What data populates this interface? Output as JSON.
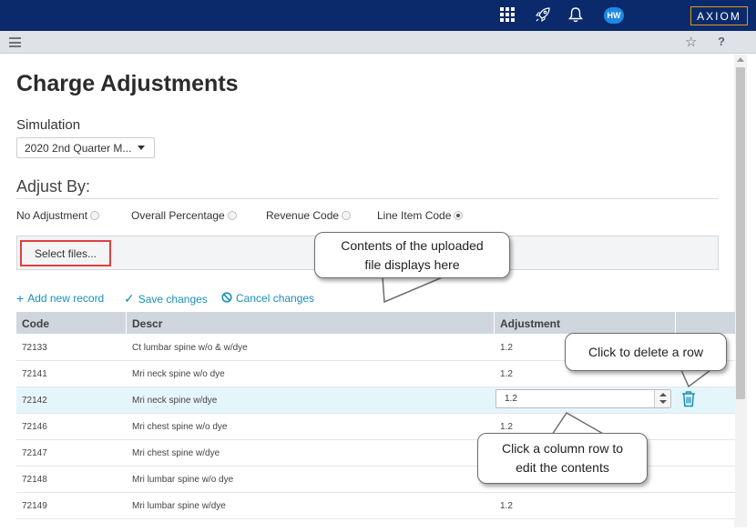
{
  "topbar": {
    "avatar_initials": "HW",
    "logo_text": "AXIOM",
    "icons": [
      "apps-grid-icon",
      "rocket-icon",
      "bell-icon"
    ],
    "background": "#0a2a6b",
    "logo_border": "#e29a1a"
  },
  "subbar": {
    "icons": [
      "hamburger-menu-icon",
      "star-icon",
      "help-icon"
    ],
    "help_label": "?"
  },
  "page": {
    "title": "Charge Adjustments",
    "simulation_label": "Simulation",
    "simulation_value": "2020 2nd Quarter M...",
    "adjust_by_label": "Adjust By:",
    "options": [
      {
        "label": "No Adjustment",
        "checked": false
      },
      {
        "label": "Overall Percentage",
        "checked": false
      },
      {
        "label": "Revenue Code",
        "checked": false
      },
      {
        "label": "Line Item Code",
        "checked": true
      }
    ],
    "select_files_label": "Select files..."
  },
  "actions": {
    "add": "Add new record",
    "save": "Save changes",
    "cancel": "Cancel changes",
    "accent": "#1a8fb8"
  },
  "grid": {
    "columns": [
      "Code",
      "Descr",
      "Adjustment"
    ],
    "rows": [
      {
        "code": "72133",
        "descr": "Ct lumbar spine w/o & w/dye",
        "adjustment": "1.2"
      },
      {
        "code": "72141",
        "descr": "Mri neck spine w/o dye",
        "adjustment": "1.2"
      },
      {
        "code": "72142",
        "descr": "Mri neck spine w/dye",
        "adjustment": "1.2"
      },
      {
        "code": "72146",
        "descr": "Mri chest spine w/o dye",
        "adjustment": "1.2"
      },
      {
        "code": "72147",
        "descr": "Mri chest spine w/dye",
        "adjustment": ""
      },
      {
        "code": "72148",
        "descr": "Mri lumbar spine w/o dye",
        "adjustment": ""
      },
      {
        "code": "72149",
        "descr": "Mri lumbar spine w/dye",
        "adjustment": "1.2"
      }
    ],
    "selected_row_index": 2,
    "editing_value": "1.2"
  },
  "callouts": {
    "upload_line1": "Contents of the uploaded",
    "upload_line2": "file displays here",
    "delete": "Click to delete a row",
    "edit_line1": "Click a column row to",
    "edit_line2": "edit the contents"
  }
}
